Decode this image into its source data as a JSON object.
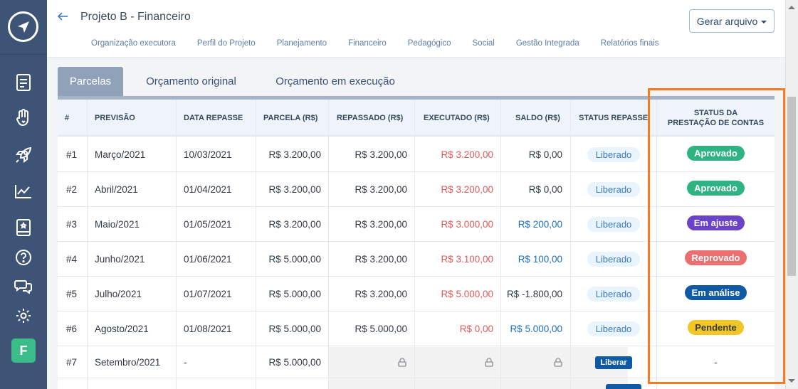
{
  "header": {
    "title": "Projeto B - Financeiro",
    "generate_button": "Gerar arquivo"
  },
  "sidebar": {
    "user_initial": "F",
    "icons": [
      "document-icon",
      "hand-heart-icon",
      "rocket-icon",
      "chart-icon",
      "book-icon",
      "help-icon",
      "chat-icon",
      "gear-icon"
    ]
  },
  "nav": [
    "Organização executora",
    "Perfil do Projeto",
    "Planejamento",
    "Financeiro",
    "Pedagógico",
    "Social",
    "Gestão Integrada",
    "Relatórios finais"
  ],
  "tabs": [
    "Parcelas",
    "Orçamento original",
    "Orçamento em execução"
  ],
  "table": {
    "columns": [
      "#",
      "PREVISÃO",
      "DATA REPASSE",
      "PARCELA (R$)",
      "REPASSADO (R$)",
      "EXECUTADO (R$)",
      "SALDO (R$)",
      "STATUS REPASSE",
      "STATUS DA",
      "PRESTAÇÃO DE CONTAS"
    ],
    "rows": [
      {
        "n": "#1",
        "previsao": "Março/2021",
        "data": "10/03/2021",
        "parcela": "R$ 3.200,00",
        "repassado": "R$ 3.200,00",
        "executado": "R$ 3.200,00",
        "saldo": "R$ 0,00",
        "status_repasse": "Liberado",
        "status_contas": "Aprovado"
      },
      {
        "n": "#2",
        "previsao": "Abril/2021",
        "data": "01/04/2021",
        "parcela": "R$ 3.200,00",
        "repassado": "R$ 3.200,00",
        "executado": "R$ 3.200,00",
        "saldo": "R$ 0,00",
        "status_repasse": "Liberado",
        "status_contas": "Aprovado"
      },
      {
        "n": "#3",
        "previsao": "Maio/2021",
        "data": "01/05/2021",
        "parcela": "R$ 3.200,00",
        "repassado": "R$ 3.200,00",
        "executado": "R$ 3.000,00",
        "saldo": "R$ 200,00",
        "status_repasse": "Liberado",
        "status_contas": "Em ajuste"
      },
      {
        "n": "#4",
        "previsao": "Junho/2021",
        "data": "01/06/2021",
        "parcela": "R$ 5.000,00",
        "repassado": "R$ 3.200,00",
        "executado": "R$ 3.100,00",
        "saldo": "R$ 100,00",
        "status_repasse": "Liberado",
        "status_contas": "Reprovado"
      },
      {
        "n": "#5",
        "previsao": "Julho/2021",
        "data": "01/07/2021",
        "parcela": "R$ 5.000,00",
        "repassado": "R$ 3.200,00",
        "executado": "R$ 5.000,00",
        "saldo": "R$ -1.800,00",
        "status_repasse": "Liberado",
        "status_contas": "Em análise"
      },
      {
        "n": "#6",
        "previsao": "Agosto/2021",
        "data": "01/08/2021",
        "parcela": "R$ 5.000,00",
        "repassado": "R$ 5.000,00",
        "executado": "R$ 0,00",
        "saldo": "R$ 5.000,00",
        "status_repasse": "Liberado",
        "status_contas": "Pendente"
      },
      {
        "n": "#7",
        "previsao": "Setembro/2021",
        "data": "-",
        "parcela": "R$ 5.000,00",
        "repassado": "",
        "executado": "",
        "saldo": "",
        "status_repasse": "Liberar",
        "status_contas": "-"
      }
    ]
  },
  "colors": {
    "sidebar": "#3d5477",
    "highlight": "#f47b20",
    "aprovado": "#2fb382",
    "em_ajuste": "#6a43c6",
    "reprovado": "#eb6f6f",
    "em_analise": "#0f5aa3",
    "pendente": "#f0c726"
  }
}
